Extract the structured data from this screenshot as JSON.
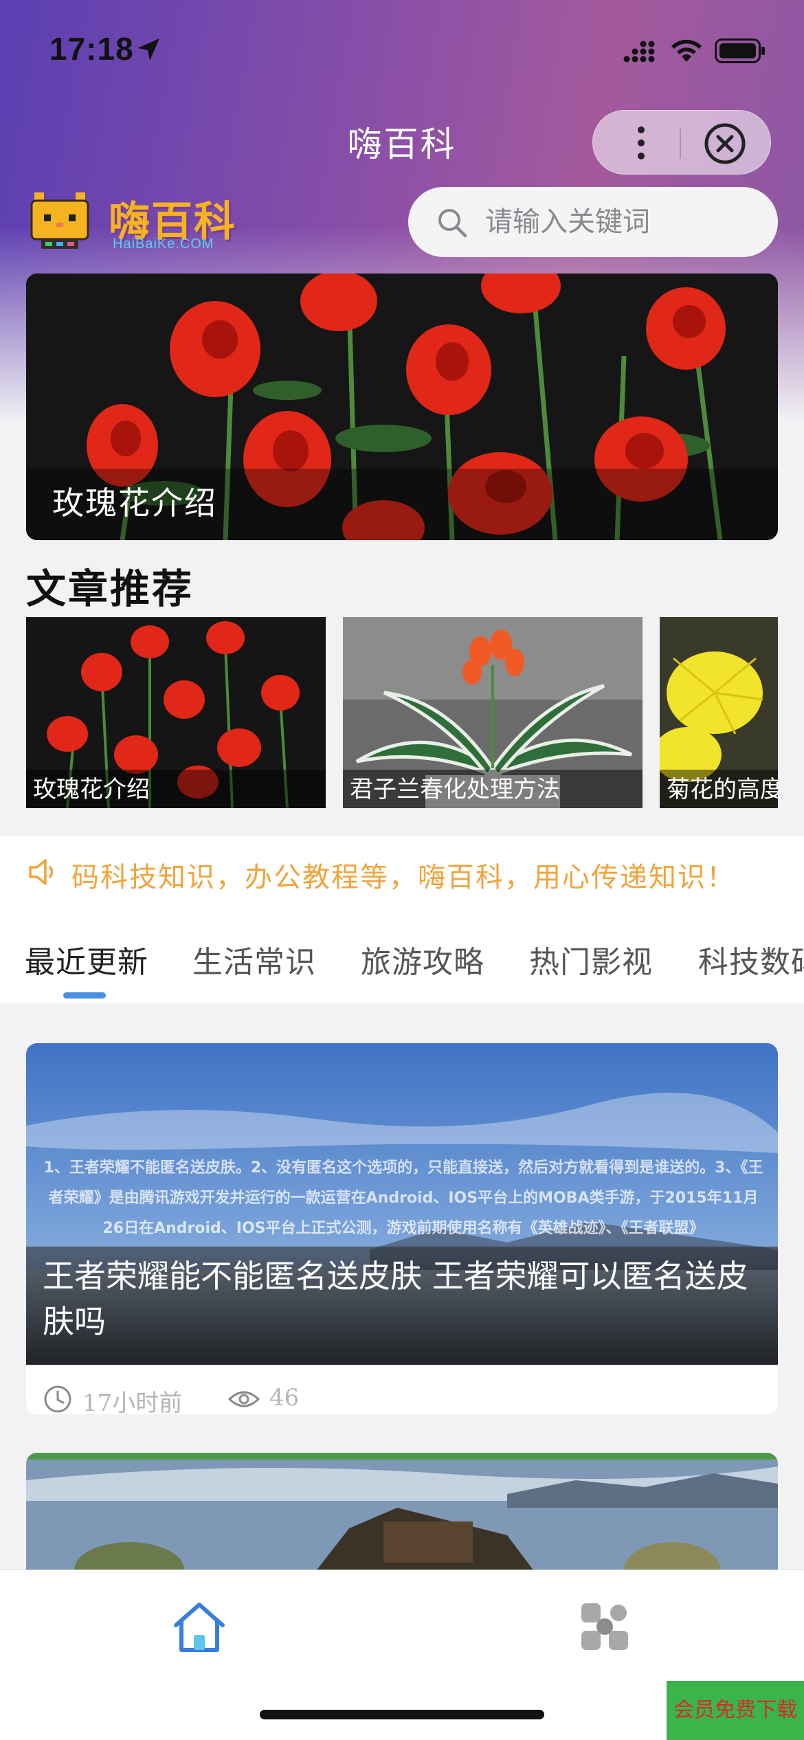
{
  "status_bar": {
    "time": "17:18"
  },
  "nav": {
    "title": "嗨百科"
  },
  "logo": {
    "text": "嗨百科",
    "domain": "HaiBaiKe.COM"
  },
  "search": {
    "placeholder": "请输入关键词"
  },
  "banner": {
    "caption": "玫瑰花介绍"
  },
  "recommend": {
    "title": "文章推荐",
    "items": [
      {
        "caption": "玫瑰花介绍"
      },
      {
        "caption": "君子兰春化处理方法"
      },
      {
        "caption": "菊花的高度"
      }
    ]
  },
  "notice": {
    "text": "码科技知识，办公教程等，嗨百科，用心传递知识！"
  },
  "tabs": [
    {
      "label": "最近更新"
    },
    {
      "label": "生活常识"
    },
    {
      "label": "旅游攻略"
    },
    {
      "label": "热门影视"
    },
    {
      "label": "科技数码"
    }
  ],
  "articles": [
    {
      "title": "王者荣耀能不能匿名送皮肤 王者荣耀可以匿名送皮肤吗",
      "image_text": "1、王者荣耀不能匿名送皮肤。2、没有匿名这个选项的，只能直接送，然后对方就看得到是谁送的。3、《王者荣耀》是由腾讯游戏开发并运行的一款运营在Android、IOS平台上的MOBA类手游，于2015年11月26日在Android、IOS平台上正式公测，游戏前期使用名称有《英雄战迹》、《王者联盟》",
      "time": "17小时前",
      "views": "46"
    }
  ],
  "vip_badge": "会员免费下载",
  "colors": {
    "accent": "#4a90e2",
    "notice": "#f0a43c",
    "logo": "#f5b320"
  }
}
